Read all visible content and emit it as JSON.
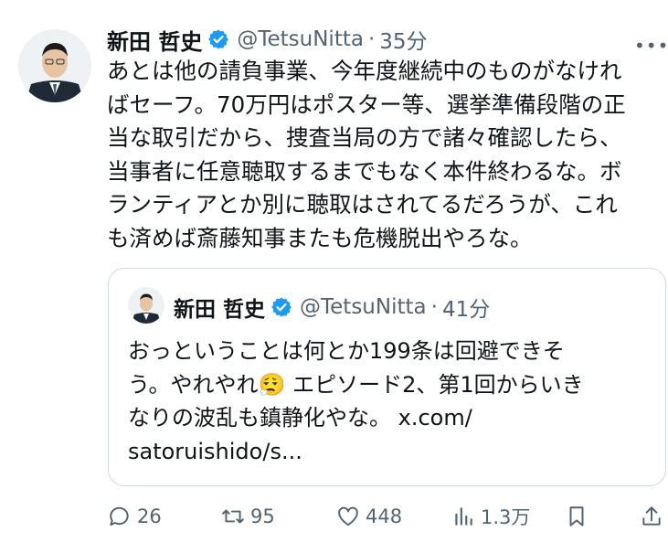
{
  "author": {
    "name": "新田 哲史",
    "handle": "@TetsuNitta",
    "separator": "·",
    "time": "35分"
  },
  "more_label": "•••",
  "tweet": {
    "lines": [
      "あとは他の請負事業、今年度継続中のものがなけれ",
      "ばセーフ。70万円はポスター等、選挙準備段階の正",
      "当な取引だから、捜査当局の方で諸々確認したら、",
      "当事者に任意聴取するまでもなく本件終わるな。ボ",
      "ランティアとか別に聴取はされてるだろうが、これ",
      "も済めば斎藤知事またも危機脱出やろな。"
    ]
  },
  "quote": {
    "name": "新田 哲史",
    "handle": "@TetsuNitta",
    "separator": "·",
    "time": "41分",
    "lines": [
      "おっということは何とか199条は回避できそ",
      "う。やれやれ😮‍💨 エピソード2、第1回からいき",
      "なりの波乱も鎮静化やな。 x.com/",
      "satoruishido/s..."
    ]
  },
  "actions": {
    "reply_count": "26",
    "repost_count": "95",
    "like_count": "448",
    "views_count": "1.3万"
  },
  "colors": {
    "text": "#0f1419",
    "muted": "#536471",
    "verified": "#1d9bf0",
    "border": "#cfd9de"
  },
  "icons": [
    "verified-badge-icon",
    "more-icon",
    "reply-icon",
    "repost-icon",
    "like-icon",
    "views-icon",
    "bookmark-icon",
    "share-icon"
  ]
}
